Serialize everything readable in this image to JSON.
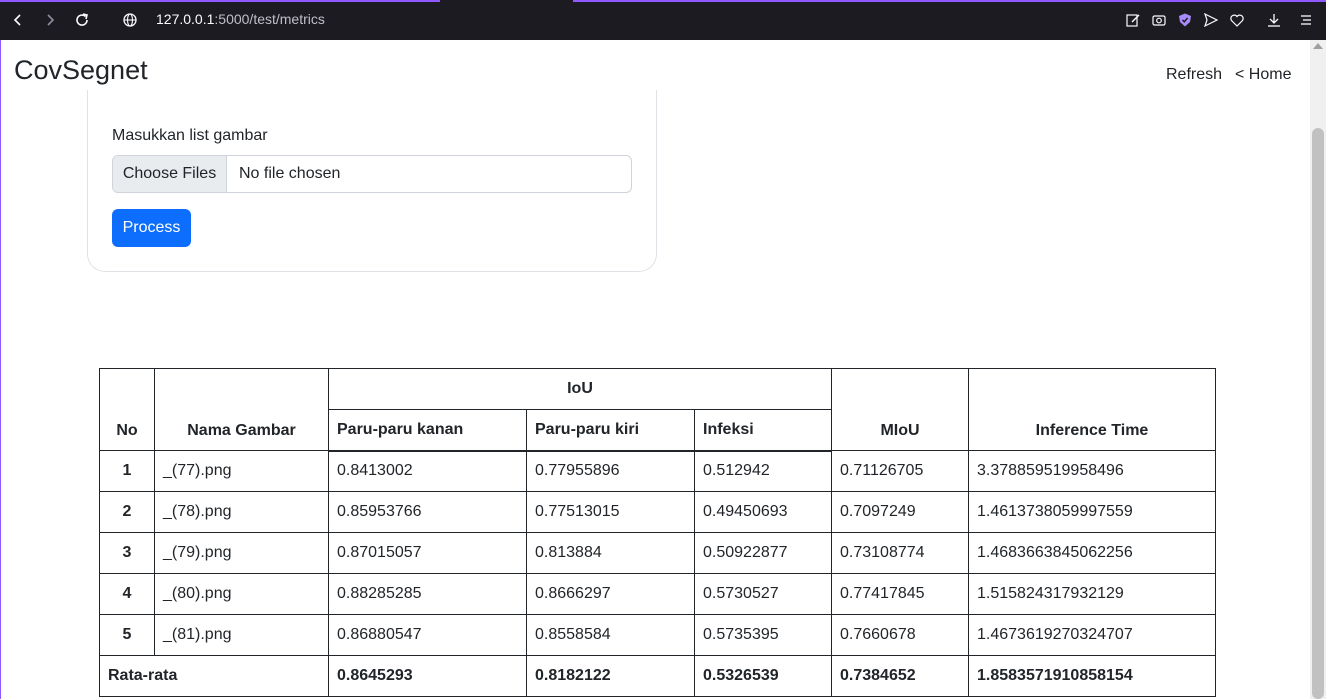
{
  "browser": {
    "url_host": "127.0.0.1",
    "url_rest": ":5000/test/metrics"
  },
  "header": {
    "brand": "CovSegnet",
    "refresh_label": "Refresh",
    "home_label": "< Home"
  },
  "form": {
    "label": "Masukkan list gambar",
    "choose_files_label": "Choose Files",
    "file_status": "No file chosen",
    "process_label": "Process"
  },
  "table": {
    "headers": {
      "no": "No",
      "name": "Nama Gambar",
      "iou": "IoU",
      "paru_kanan": "Paru-paru kanan",
      "paru_kiri": "Paru-paru kiri",
      "infeksi": "Infeksi",
      "miou": "MIoU",
      "inference_time": "Inference Time"
    },
    "rows": [
      {
        "no": "1",
        "name": "_(77).png",
        "kanan": "0.8413002",
        "kiri": "0.77955896",
        "infeksi": "0.512942",
        "miou": "0.71126705",
        "time": "3.378859519958496"
      },
      {
        "no": "2",
        "name": "_(78).png",
        "kanan": "0.85953766",
        "kiri": "0.77513015",
        "infeksi": "0.49450693",
        "miou": "0.7097249",
        "time": "1.4613738059997559"
      },
      {
        "no": "3",
        "name": "_(79).png",
        "kanan": "0.87015057",
        "kiri": "0.813884",
        "infeksi": "0.50922877",
        "miou": "0.73108774",
        "time": "1.4683663845062256"
      },
      {
        "no": "4",
        "name": "_(80).png",
        "kanan": "0.88285285",
        "kiri": "0.8666297",
        "infeksi": "0.5730527",
        "miou": "0.77417845",
        "time": "1.515824317932129"
      },
      {
        "no": "5",
        "name": "_(81).png",
        "kanan": "0.86880547",
        "kiri": "0.8558584",
        "infeksi": "0.5735395",
        "miou": "0.7660678",
        "time": "1.4673619270324707"
      }
    ],
    "average": {
      "label": "Rata-rata",
      "kanan": "0.8645293",
      "kiri": "0.8182122",
      "infeksi": "0.5326539",
      "miou": "0.7384652",
      "time": "1.8583571910858154"
    }
  }
}
